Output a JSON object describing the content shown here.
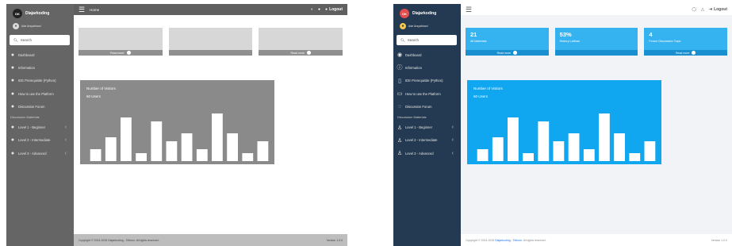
{
  "brand": {
    "name": "Diajarkoding",
    "logo_text": "DK"
  },
  "user": {
    "name": "Ade Arsyahhani"
  },
  "search": {
    "placeholder": "Search"
  },
  "menu": [
    {
      "label": "Dashboard",
      "icon": "dashboard-icon"
    },
    {
      "label": "Information",
      "icon": "info-icon"
    },
    {
      "label": "IDE Prerequisite (Python)",
      "icon": "file-code-icon"
    },
    {
      "label": "How to use the Platform",
      "icon": "laptop-icon"
    },
    {
      "label": "Discussion Forum",
      "icon": "chat-icon"
    }
  ],
  "menu_section": "Discussion Materials",
  "levels": [
    {
      "label": "Level 1 - Beginner"
    },
    {
      "label": "Level 2 - Intermediate"
    },
    {
      "label": "Level 3 - Advanced"
    }
  ],
  "topbar": {
    "breadcrumb": "Home",
    "logout": "Logout"
  },
  "cards": [
    {
      "value": "21",
      "label": "All Materials",
      "link": "Read more"
    },
    {
      "value": "53%",
      "label": "History Latihan",
      "link": ""
    },
    {
      "value": "4",
      "label": "Forum Discussion Topic",
      "link": "Read more"
    }
  ],
  "chart": {
    "title": "Number of Visitors",
    "subtitle": "50 Users"
  },
  "chart_data": {
    "type": "bar",
    "values": [
      3,
      6,
      11,
      2,
      10,
      5,
      7,
      3,
      12,
      7,
      2,
      5
    ],
    "title": "Number of Visitors"
  },
  "footer": {
    "copyright_prefix": "Copyright © 2024-2025",
    "copyright_link": "Diajarkoding - Telkom",
    "copyright_suffix": "All rights reserved.",
    "version": "Version 1.0.0"
  },
  "colors": {
    "sidebar_right": "#243a52",
    "accent_blue": "#10a7f0",
    "card_blue": "#35b3f1",
    "sidebar_left": "#656565"
  }
}
